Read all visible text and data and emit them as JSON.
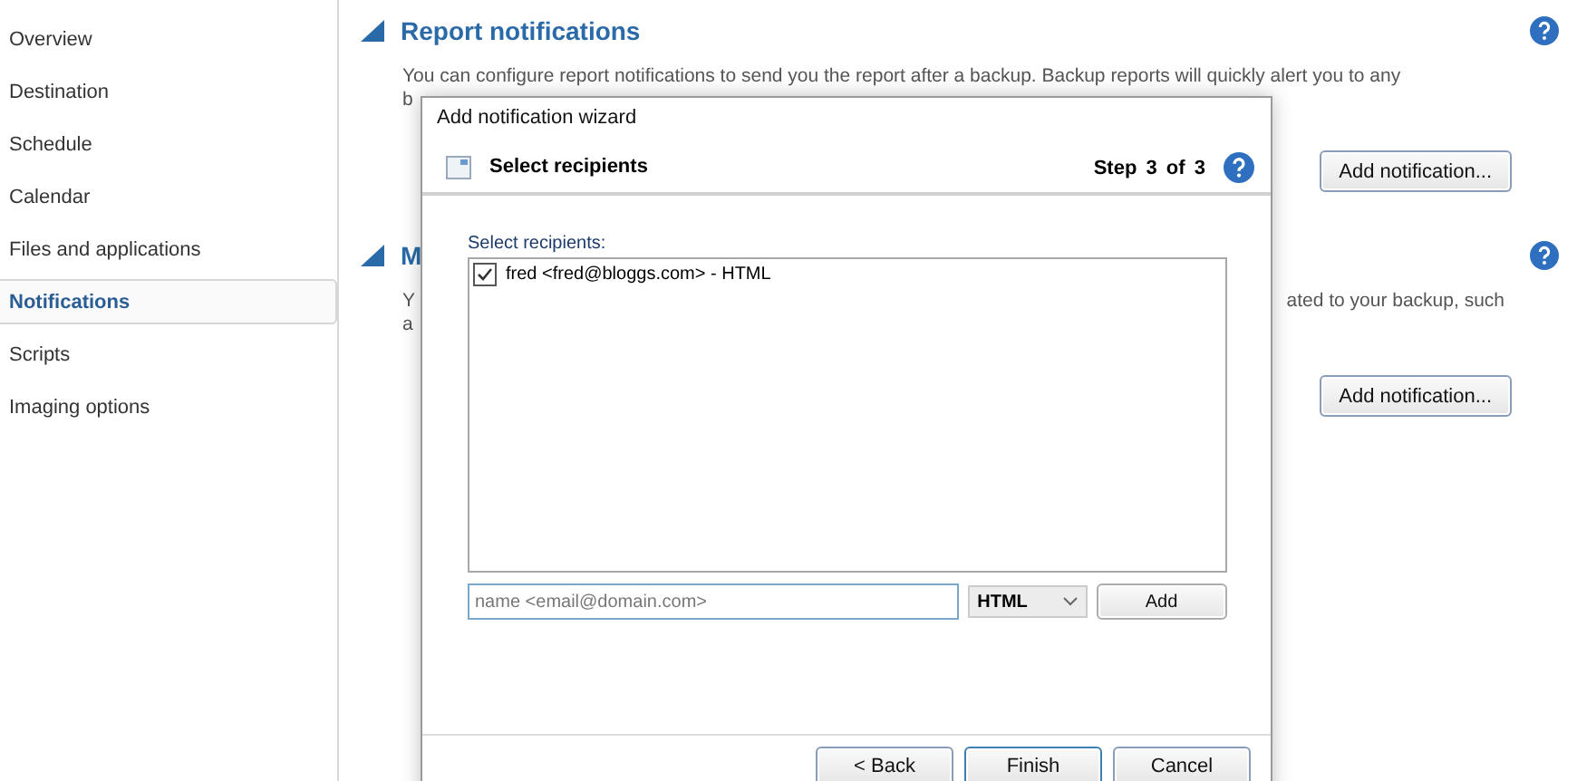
{
  "sidebar": {
    "items": [
      {
        "label": "Overview",
        "selected": false
      },
      {
        "label": "Destination",
        "selected": false
      },
      {
        "label": "Schedule",
        "selected": false
      },
      {
        "label": "Calendar",
        "selected": false
      },
      {
        "label": "Files and applications",
        "selected": false
      },
      {
        "label": "Notifications",
        "selected": true
      },
      {
        "label": "Scripts",
        "selected": false
      },
      {
        "label": "Imaging options",
        "selected": false
      }
    ]
  },
  "sections": [
    {
      "heading": "Report notifications",
      "lines": [
        {
          "left": "You can configure report notifications to send you the report after a backup. Backup reports will quickly alert you to any"
        },
        {
          "left": "b"
        }
      ],
      "button": "Add notification..."
    },
    {
      "heading": "M",
      "lines": [
        {
          "left": "Y",
          "right": "ated to your backup, such"
        },
        {
          "left": "a"
        }
      ],
      "button": "Add notification..."
    }
  ],
  "dialog": {
    "title": "Add notification wizard",
    "page_title": "Select recipients",
    "step": [
      "Step",
      "3",
      "of",
      "3"
    ],
    "list_label": "Select recipients:",
    "recipients": [
      {
        "label": "fred <fred@bloggs.com> - HTML",
        "checked": true
      }
    ],
    "input": {
      "placeholder": "name <email@domain.com>"
    },
    "format": "HTML",
    "add_button": "Add",
    "buttons": [
      "< Back",
      "Finish",
      "Cancel"
    ]
  }
}
